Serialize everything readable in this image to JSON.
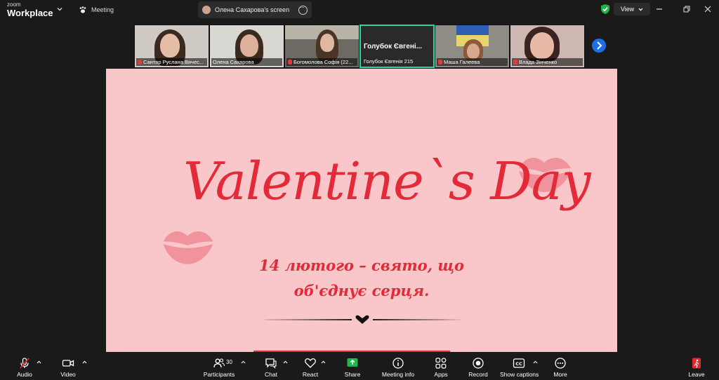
{
  "app": {
    "brand_small": "zoom",
    "brand_large": "Workplace",
    "meeting_label": "Meeting",
    "sharing_label": "Олена Сахарова's screen",
    "view_label": "View"
  },
  "participants": [
    {
      "name": "Сантар Руслана Вячес...",
      "muted": true
    },
    {
      "name": "Олена Сахарова",
      "muted": false
    },
    {
      "name": "Богомолова Софія (22...",
      "muted": true
    },
    {
      "name": "Голубок Євгенія 215",
      "display_name": "Голубок Євгені...",
      "muted": false,
      "active": true
    },
    {
      "name": "Маша Галеева",
      "muted": true
    },
    {
      "name": "Влада Зінченко",
      "muted": true
    }
  ],
  "slide": {
    "title": "Valentine`s Day",
    "line1": "14 лютого – свято, що",
    "line2": "об'єднує серця."
  },
  "toolbar": {
    "audio": "Audio",
    "video": "Video",
    "participants": "Participants",
    "participants_count": "30",
    "chat": "Chat",
    "react": "React",
    "share": "Share",
    "meeting_info": "Meeting info",
    "apps": "Apps",
    "record": "Record",
    "captions": "Show captions",
    "more": "More",
    "leave": "Leave"
  },
  "colors": {
    "slide_bg": "#f9c6c9",
    "slide_text": "#e32a38",
    "active_speaker": "#2bd4a4",
    "share_green": "#1fb64d",
    "accent_blue": "#1d6fe8",
    "leave_red": "#e0282e"
  }
}
